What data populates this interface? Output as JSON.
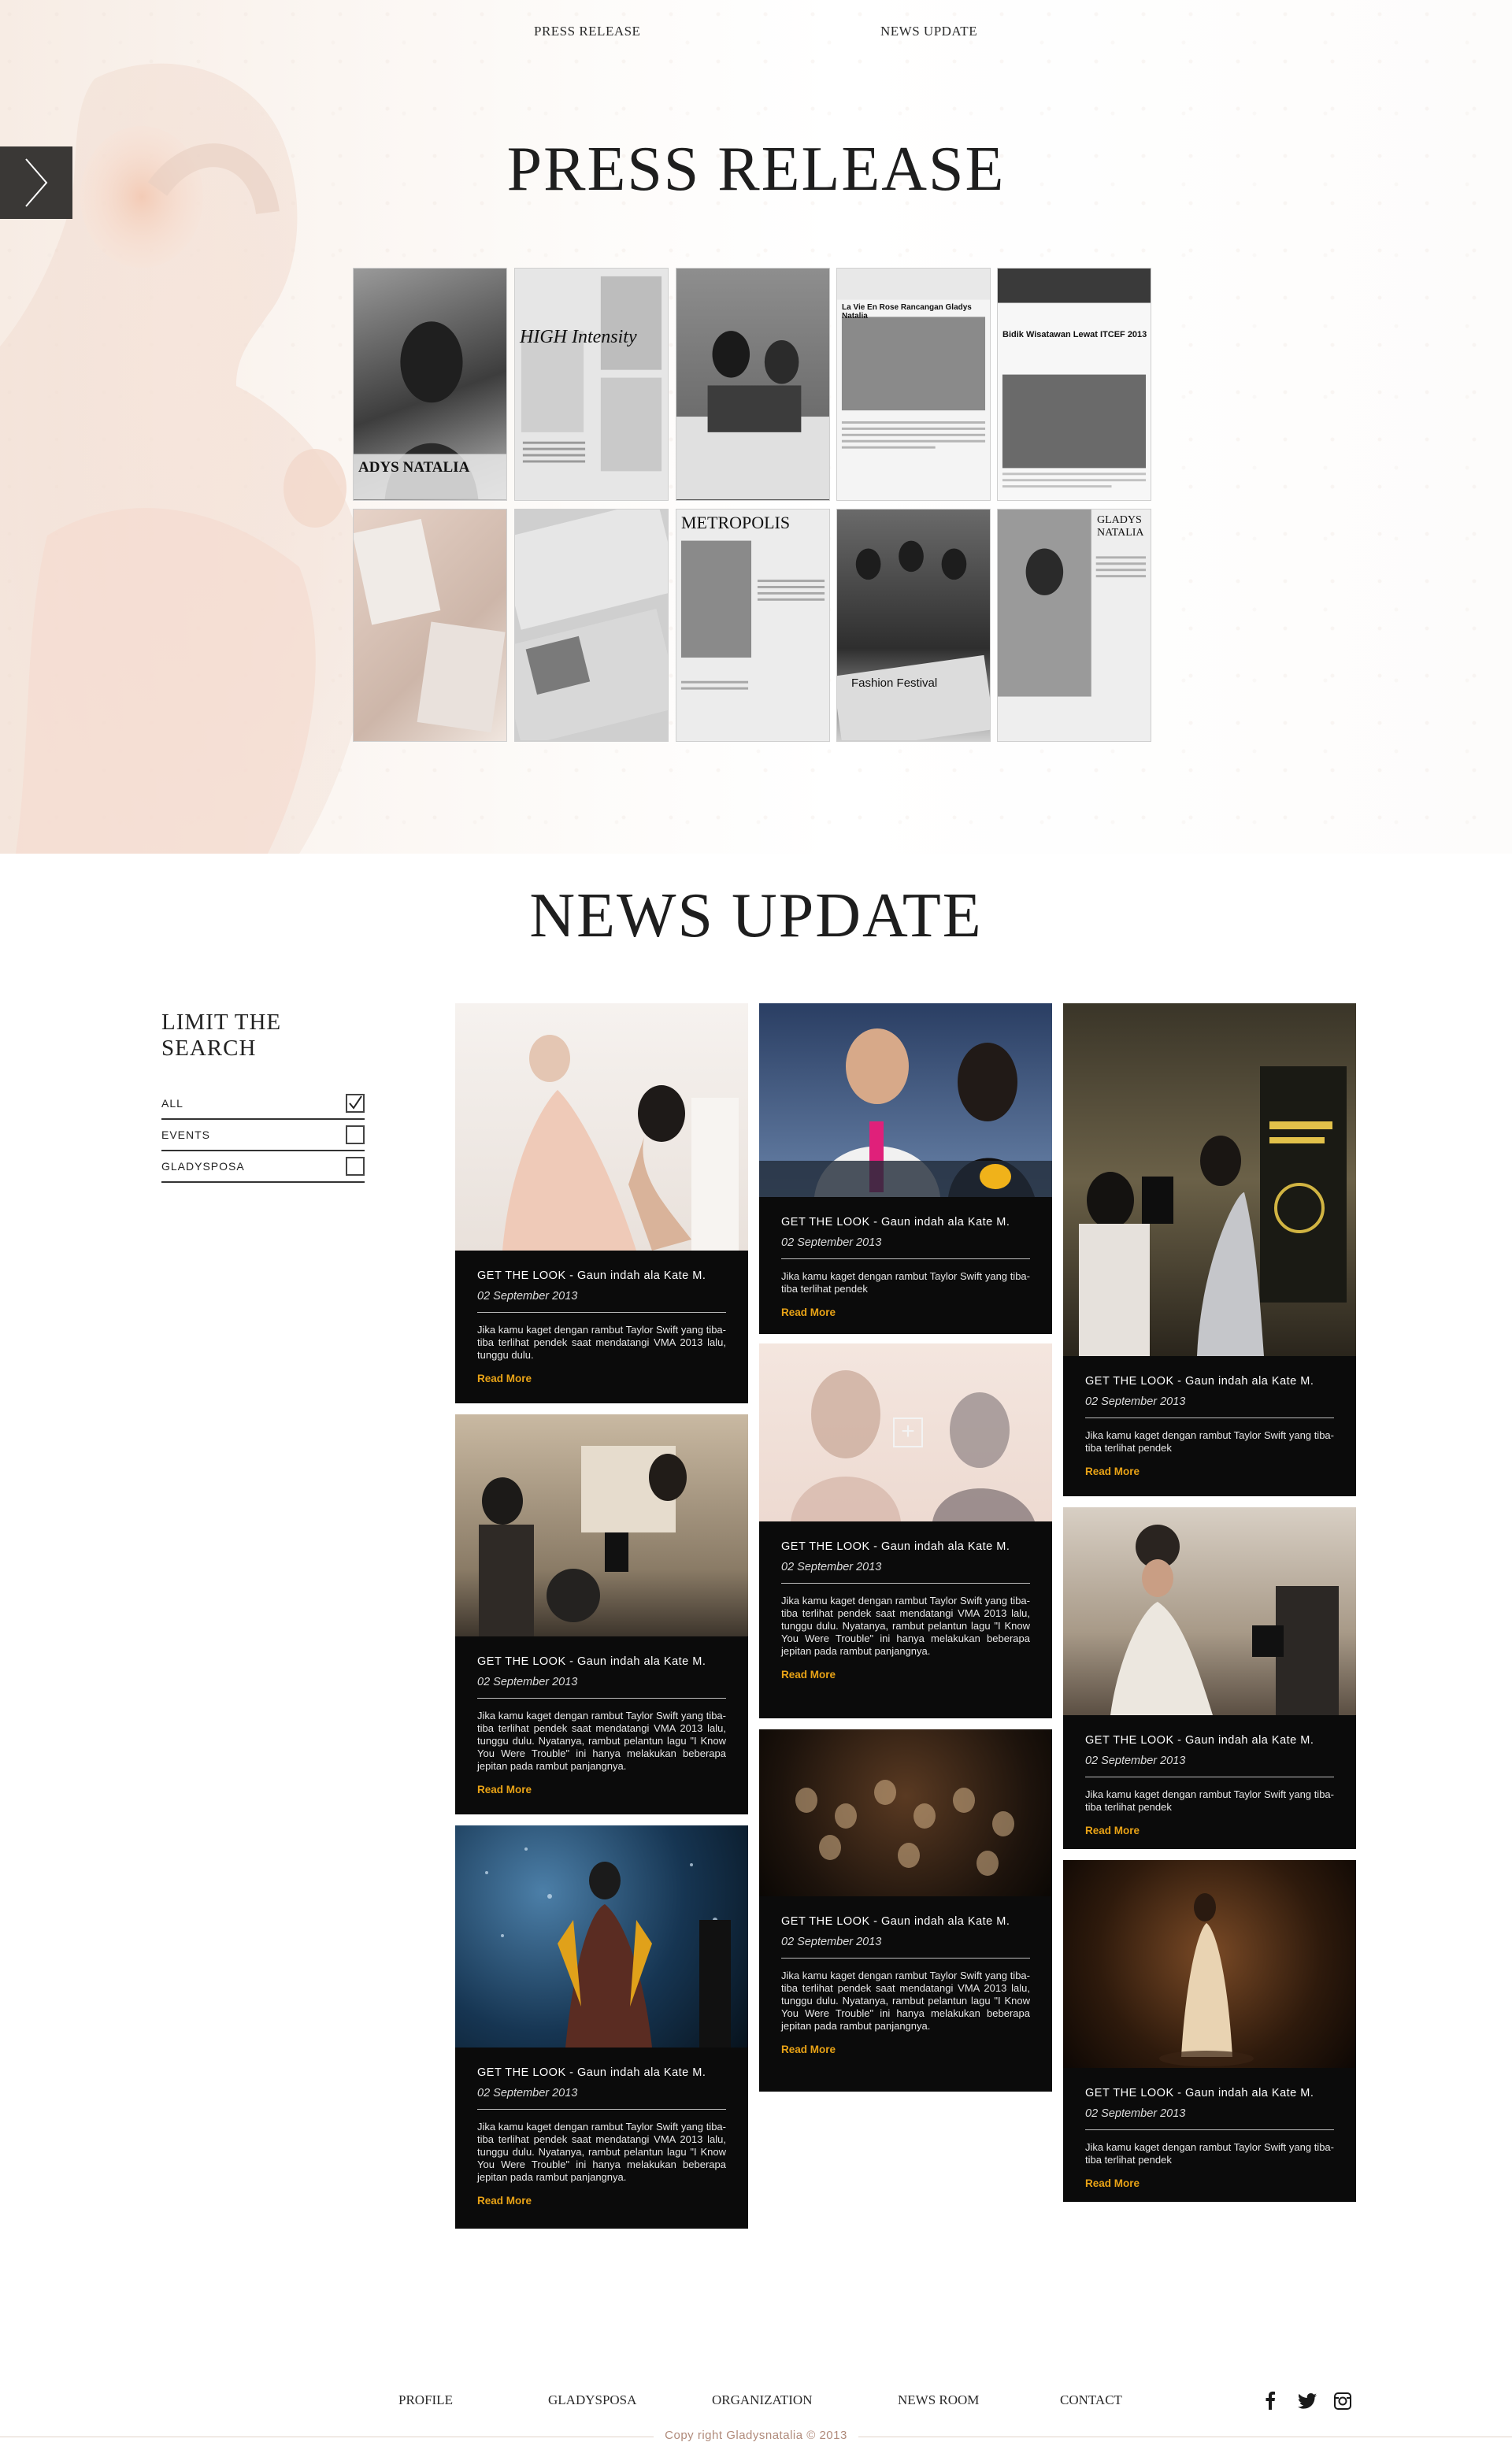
{
  "nav": {
    "press_release": "PRESS RELEASE",
    "news_update": "NEWS UPDATE"
  },
  "press": {
    "title": "PRESS RELEASE",
    "thumbs": [
      {
        "caption": "ADYS NATALIA"
      },
      {
        "caption": "HIGH Intensity"
      },
      {
        "caption": ""
      },
      {
        "caption": "La Vie En Rose Rancangan Gladys Natalia"
      },
      {
        "caption": "Bidik Wisatawan Lewat ITCEF 2013"
      },
      {
        "caption": ""
      },
      {
        "caption": ""
      },
      {
        "caption": "METROPOLIS"
      },
      {
        "caption": "Fashion Festival"
      },
      {
        "caption": "GLADYS NATALIA"
      }
    ]
  },
  "news": {
    "title": "NEWS UPDATE",
    "filter": {
      "title": "LIMIT THE SEARCH",
      "options": [
        {
          "label": "ALL",
          "checked": true
        },
        {
          "label": "EVENTS",
          "checked": false
        },
        {
          "label": "GLADYSPOSA",
          "checked": false
        }
      ]
    },
    "cards": [
      {
        "title": "GET THE LOOK - Gaun indah ala Kate M.",
        "date": "02 September 2013",
        "text": "Jika kamu kaget dengan rambut Taylor Swift yang tiba-tiba terlihat pendek saat mendatangi VMA 2013 lalu, tunggu dulu.",
        "more": "Read More"
      },
      {
        "title": "GET THE LOOK - Gaun indah ala Kate M.",
        "date": "02 September 2013",
        "text": "Jika kamu kaget dengan rambut Taylor Swift yang tiba-tiba terlihat pendek saat mendatangi VMA 2013 lalu, tunggu dulu. Nyatanya, rambut pelantun lagu \"I Know You Were Trouble\" ini hanya melakukan beberapa jepitan pada rambut panjangnya.",
        "more": "Read More"
      },
      {
        "title": "GET THE LOOK - Gaun indah ala Kate M.",
        "date": "02 September 2013",
        "text": "Jika kamu kaget dengan rambut Taylor Swift yang tiba-tiba terlihat pendek saat mendatangi VMA 2013 lalu, tunggu dulu. Nyatanya, rambut pelantun lagu \"I Know You Were Trouble\" ini hanya melakukan beberapa jepitan pada rambut panjangnya.",
        "more": "Read More"
      },
      {
        "title": "GET THE LOOK - Gaun indah ala Kate M.",
        "date": "02 September 2013",
        "text": "Jika kamu kaget dengan rambut Taylor Swift yang tiba-tiba terlihat pendek",
        "more": "Read More"
      },
      {
        "title": "GET THE LOOK - Gaun indah ala Kate M.",
        "date": "02 September 2013",
        "text": "Jika kamu kaget dengan rambut Taylor Swift yang tiba-tiba terlihat pendek saat mendatangi VMA 2013 lalu, tunggu dulu. Nyatanya, rambut pelantun lagu \"I Know You Were Trouble\" ini hanya melakukan beberapa jepitan pada rambut panjangnya.",
        "more": "Read More"
      },
      {
        "title": "GET THE LOOK - Gaun indah ala Kate M.",
        "date": "02 September 2013",
        "text": "Jika kamu kaget dengan rambut Taylor Swift yang tiba-tiba terlihat pendek saat mendatangi VMA 2013 lalu, tunggu dulu. Nyatanya, rambut pelantun lagu \"I Know You Were Trouble\" ini hanya melakukan beberapa jepitan pada rambut panjangnya.",
        "more": "Read More"
      },
      {
        "title": "GET THE LOOK - Gaun indah ala Kate M.",
        "date": "02 September 2013",
        "text": "Jika kamu kaget dengan rambut Taylor Swift yang tiba-tiba terlihat pendek",
        "more": "Read More"
      },
      {
        "title": "GET THE LOOK - Gaun indah ala Kate M.",
        "date": "02 September 2013",
        "text": "Jika kamu kaget dengan rambut Taylor Swift yang tiba-tiba terlihat pendek",
        "more": "Read More"
      },
      {
        "title": "GET THE LOOK - Gaun indah ala Kate M.",
        "date": "02 September 2013",
        "text": "Jika kamu kaget dengan rambut Taylor Swift yang tiba-tiba terlihat pendek",
        "more": "Read More"
      }
    ]
  },
  "footer": {
    "links": [
      "PROFILE",
      "GLADYSPOSA",
      "ORGANIZATION",
      "NEWS ROOM",
      "CONTACT"
    ],
    "social_icons": [
      "facebook-icon",
      "twitter-icon",
      "instagram-icon"
    ],
    "copyright": "Copy right Gladysnatalia © 2013"
  },
  "colors": {
    "accent": "#e9a316",
    "card_bg": "#0b0b0b",
    "copyright": "#b08a7a"
  }
}
